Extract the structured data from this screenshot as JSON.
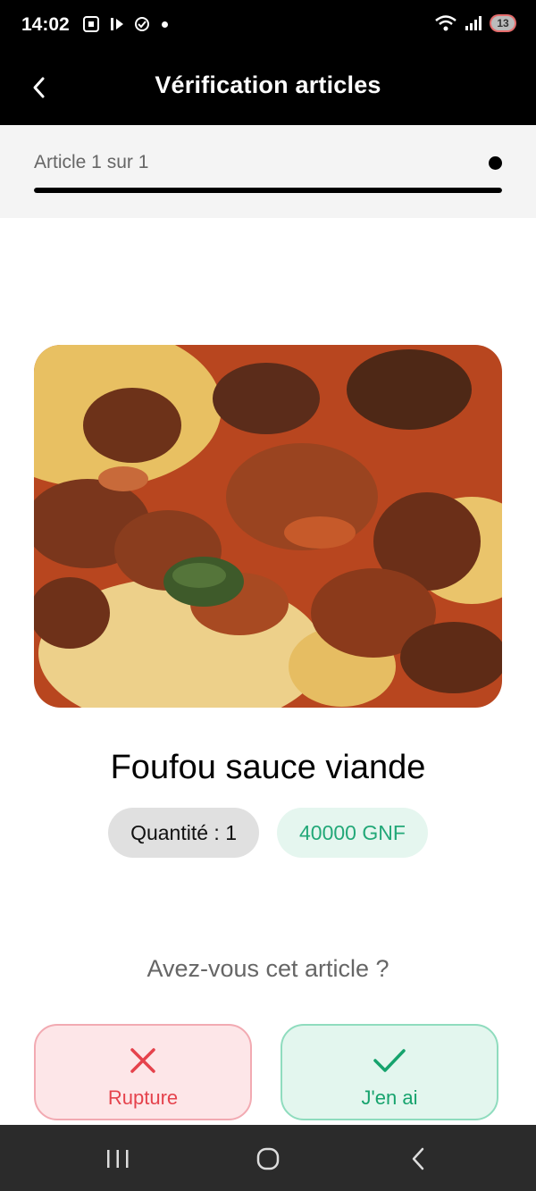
{
  "status_bar": {
    "time": "14:02",
    "battery_level": "13",
    "battery_color": "#e56c6c"
  },
  "app_bar": {
    "title": "Vérification articles",
    "back_icon": "chevron-left-icon"
  },
  "progress": {
    "label": "Article 1 sur 1",
    "current": 1,
    "total": 1,
    "fraction": 1.0
  },
  "product": {
    "name": "Foufou sauce viande",
    "quantity_label": "Quantité : 1",
    "price_label": "40000 GNF",
    "price_color": "#22a878"
  },
  "question": "Avez-vous cet article ?",
  "actions": {
    "rupture": {
      "label": "Rupture",
      "icon": "close-icon",
      "color": "#e5424c"
    },
    "have": {
      "label": "J'en ai",
      "icon": "check-icon",
      "color": "#16a36d"
    }
  },
  "nav_bar": {
    "recent_icon": "recent-apps-icon",
    "home_icon": "home-icon",
    "back_icon": "back-icon"
  }
}
